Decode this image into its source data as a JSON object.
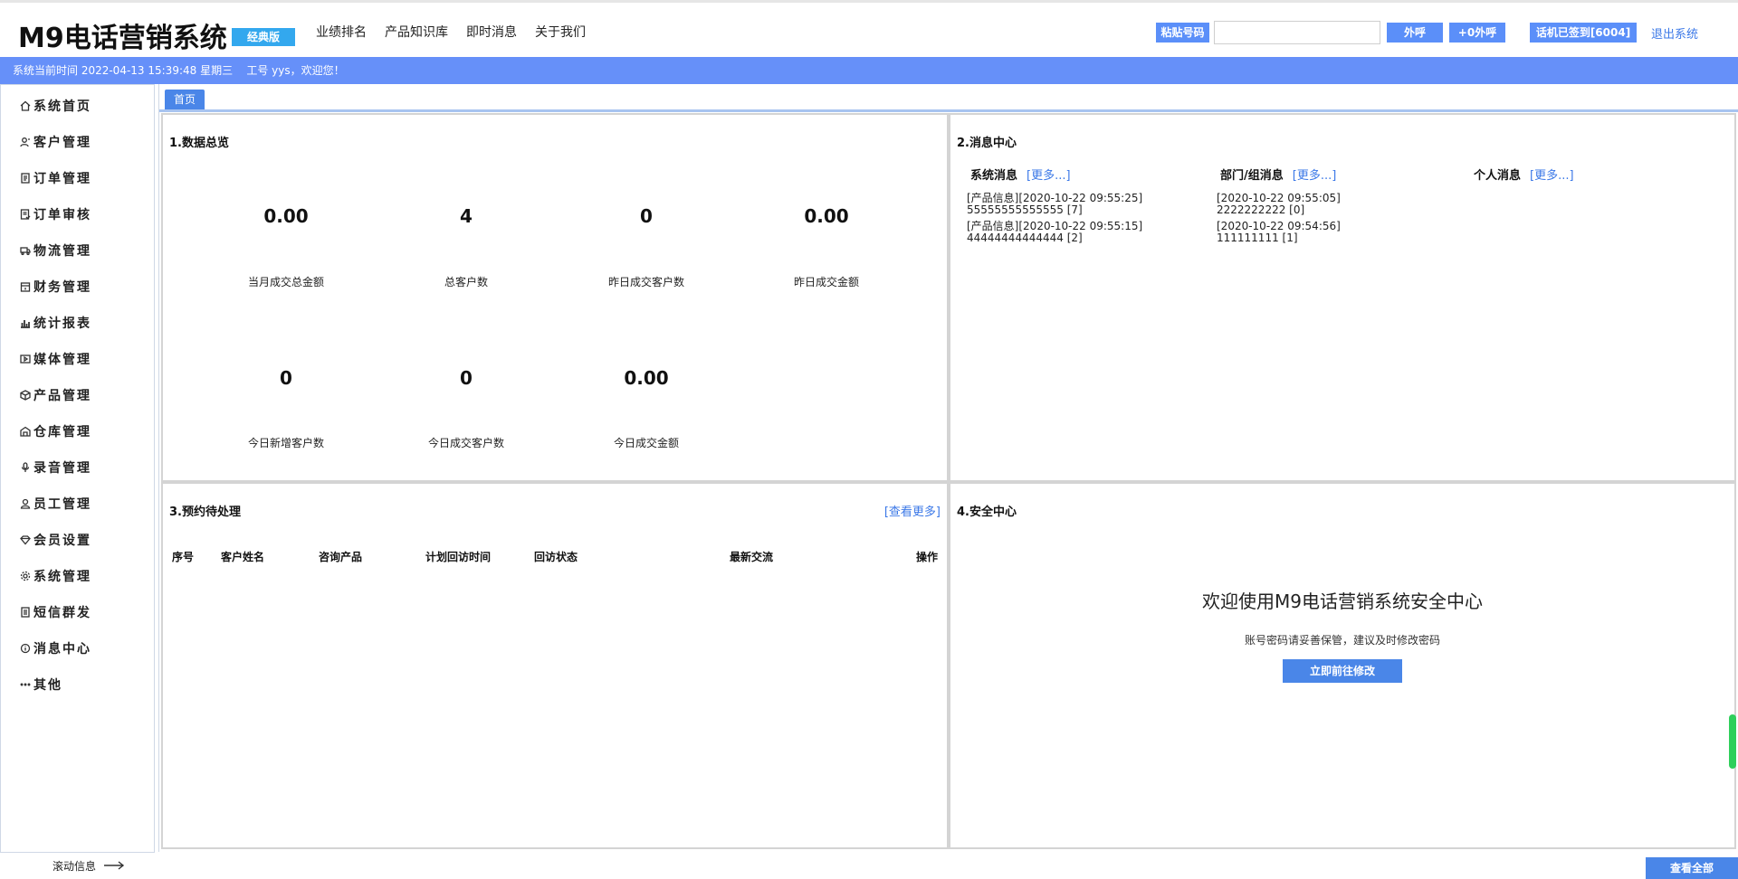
{
  "header": {
    "logo": "M9电话营销系统",
    "edition": "经典版",
    "nav": [
      "业绩排名",
      "产品知识库",
      "即时消息",
      "关于我们"
    ],
    "paste_label": "粘贴号码",
    "phone_value": "",
    "call_label": "外呼",
    "call0_label": "+0外呼",
    "phone_status": "话机已签到[6004]",
    "logout_label": "退出系统"
  },
  "infobar": {
    "text": "系统当前时间 2022-04-13 15:39:48 星期三    工号 yys，欢迎您！"
  },
  "sidebar": {
    "items": [
      {
        "label": "系统首页",
        "icon": "home-icon"
      },
      {
        "label": "客户管理",
        "icon": "customers-icon"
      },
      {
        "label": "订单管理",
        "icon": "order-icon"
      },
      {
        "label": "订单审核",
        "icon": "order-review-icon"
      },
      {
        "label": "物流管理",
        "icon": "logistics-icon"
      },
      {
        "label": "财务管理",
        "icon": "finance-icon"
      },
      {
        "label": "统计报表",
        "icon": "chart-icon"
      },
      {
        "label": "媒体管理",
        "icon": "media-icon"
      },
      {
        "label": "产品管理",
        "icon": "product-icon"
      },
      {
        "label": "仓库管理",
        "icon": "warehouse-icon"
      },
      {
        "label": "录音管理",
        "icon": "microphone-icon"
      },
      {
        "label": "员工管理",
        "icon": "employee-icon"
      },
      {
        "label": "会员设置",
        "icon": "diamond-icon"
      },
      {
        "label": "系统管理",
        "icon": "gear-icon"
      },
      {
        "label": "短信群发",
        "icon": "sms-icon"
      },
      {
        "label": "消息中心",
        "icon": "info-icon"
      },
      {
        "label": "其他",
        "icon": "more-icon"
      }
    ]
  },
  "tabs": {
    "home": "首页"
  },
  "overview": {
    "title": "1.数据总览",
    "stats": [
      {
        "value": "0.00",
        "label": "当月成交总金额"
      },
      {
        "value": "4",
        "label": "总客户数"
      },
      {
        "value": "0",
        "label": "昨日成交客户数"
      },
      {
        "value": "0.00",
        "label": "昨日成交金额"
      },
      {
        "value": "0",
        "label": "今日新增客户数"
      },
      {
        "value": "0",
        "label": "今日成交客户数"
      },
      {
        "value": "0.00",
        "label": "今日成交金额"
      }
    ]
  },
  "messages": {
    "title": "2.消息中心",
    "more": "[更多...]",
    "columns": [
      {
        "title": "系统消息",
        "entries": [
          {
            "line1": "[产品信息][2020-10-22 09:55:25]",
            "line2": "55555555555555 [7]"
          },
          {
            "line1": "[产品信息][2020-10-22 09:55:15]",
            "line2": "44444444444444 [2]"
          }
        ]
      },
      {
        "title": "部门/组消息",
        "entries": [
          {
            "line1": "[2020-10-22 09:55:05]",
            "line2": "2222222222 [0]"
          },
          {
            "line1": "[2020-10-22 09:54:56]",
            "line2": "111111111 [1]"
          }
        ]
      },
      {
        "title": "个人消息",
        "entries": []
      }
    ]
  },
  "appointments": {
    "title": "3.预约待处理",
    "see_more": "[查看更多]",
    "headers": [
      "序号",
      "客户姓名",
      "咨询产品",
      "计划回访时间",
      "回访状态",
      "最新交流",
      "操作"
    ]
  },
  "security": {
    "title": "4.安全中心",
    "headline": "欢迎使用M9电话营销系统安全中心",
    "sub": "账号密码请妥善保管，建议及时修改密码",
    "button": "立即前往修改"
  },
  "footer": {
    "ticker": "滚动信息",
    "view_all": "查看全部"
  }
}
